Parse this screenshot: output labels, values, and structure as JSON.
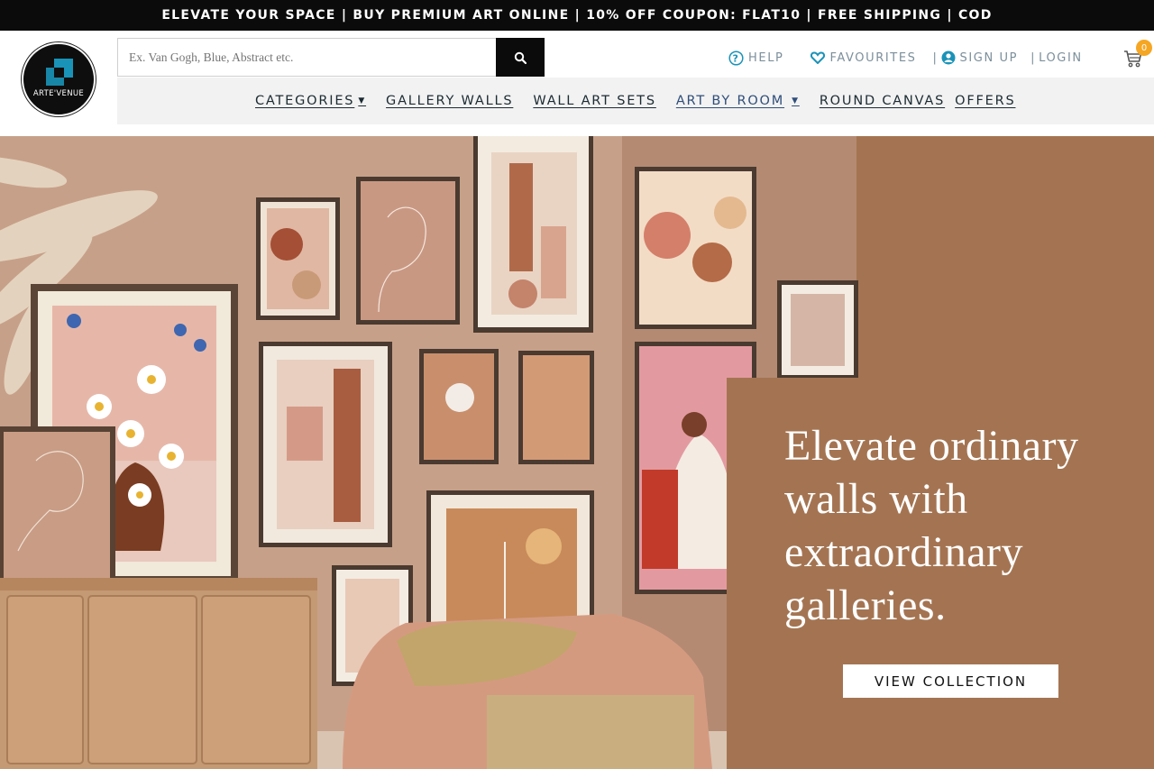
{
  "announcement": {
    "text": "ELEVATE YOUR SPACE | BUY PREMIUM ART ONLINE | 10% OFF COUPON: FLAT10 | FREE SHIPPING | COD"
  },
  "brand": {
    "logo_text": "ARTE'VENUE",
    "logo_icon": "square-corner-icon",
    "accent_color": "#1a93b8"
  },
  "search": {
    "placeholder": "Ex. Van Gogh, Blue, Abstract etc.",
    "value": "",
    "button_icon": "search-icon"
  },
  "top_links": [
    {
      "label": "HELP",
      "icon": "question-circle-icon"
    },
    {
      "label": "FAVOURITES",
      "icon": "heart-icon"
    },
    {
      "label": "SIGN UP",
      "icon": "user-icon"
    },
    {
      "label": "LOGIN"
    }
  ],
  "cart": {
    "icon": "cart-icon",
    "count": "0",
    "badge_color": "#f5a623"
  },
  "nav": {
    "items": [
      {
        "label": "CATEGORIES",
        "dropdown": true
      },
      {
        "label": "GALLERY WALLS",
        "dropdown": false
      },
      {
        "label": "WALL ART SETS",
        "dropdown": false
      },
      {
        "label": "ART BY ROOM",
        "dropdown": true
      },
      {
        "label": "ROUND CANVAS",
        "dropdown": false
      },
      {
        "label": "OFFERS",
        "dropdown": false
      }
    ]
  },
  "hero": {
    "headline": "Elevate ordinary walls with extraordinary galleries.",
    "cta_label": "VIEW COLLECTION",
    "panel_color": "#a47452",
    "wall_color": "#c29a82"
  }
}
